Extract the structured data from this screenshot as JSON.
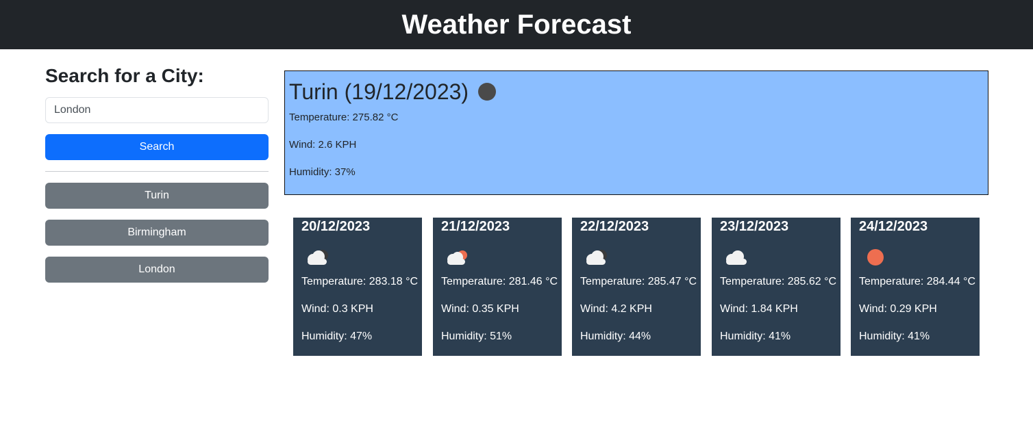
{
  "header": {
    "title": "Weather Forecast"
  },
  "search": {
    "heading": "Search for a City:",
    "input_value": "London",
    "button_label": "Search"
  },
  "history": [
    "Turin",
    "Birmingham",
    "London"
  ],
  "current": {
    "title": "Turin (19/12/2023)",
    "icon": "dark-circle-icon",
    "temperature": "Temperature: 275.82 °C",
    "wind": "Wind: 2.6 KPH",
    "humidity": "Humidity: 37%"
  },
  "forecast": [
    {
      "date": "20/12/2023",
      "icon": "cloud-dark-icon",
      "temperature": "Temperature: 283.18 °C",
      "wind": "Wind: 0.3 KPH",
      "humidity": "Humidity: 47%"
    },
    {
      "date": "21/12/2023",
      "icon": "cloud-sun-icon",
      "temperature": "Temperature: 281.46 °C",
      "wind": "Wind: 0.35 KPH",
      "humidity": "Humidity: 51%"
    },
    {
      "date": "22/12/2023",
      "icon": "cloud-dark-icon",
      "temperature": "Temperature: 285.47 °C",
      "wind": "Wind: 4.2 KPH",
      "humidity": "Humidity: 44%"
    },
    {
      "date": "23/12/2023",
      "icon": "cloud-icon",
      "temperature": "Temperature: 285.62 °C",
      "wind": "Wind: 1.84 KPH",
      "humidity": "Humidity: 41%"
    },
    {
      "date": "24/12/2023",
      "icon": "sun-icon",
      "temperature": "Temperature: 284.44 °C",
      "wind": "Wind: 0.29 KPH",
      "humidity": "Humidity: 41%"
    }
  ],
  "colors": {
    "header_bg": "#212529",
    "primary": "#0d6efd",
    "secondary": "#6c757d",
    "current_bg": "#8bbeff",
    "card_bg": "#2c3e50",
    "sun": "#ee6e50"
  }
}
